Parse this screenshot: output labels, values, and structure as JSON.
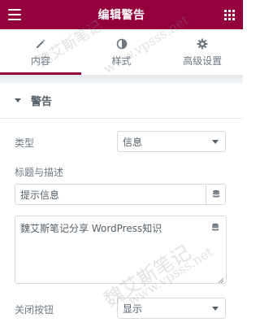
{
  "header": {
    "title": "编辑警告"
  },
  "tabs": [
    {
      "label": "内容",
      "icon": "pencil-icon",
      "active": true
    },
    {
      "label": "样式",
      "icon": "half-circle-icon",
      "active": false
    },
    {
      "label": "高级设置",
      "icon": "gear-icon",
      "active": false
    }
  ],
  "section": {
    "title": "警告"
  },
  "fields": {
    "type_label": "类型",
    "type_value": "信息",
    "title_desc_label": "标题与描述",
    "title_value": "提示信息",
    "description_value": "魏艾斯笔记分享 WordPress知识",
    "close_button_label": "关闭按钮",
    "close_button_value": "显示"
  },
  "watermarks": {
    "w1": "魏艾斯笔记",
    "w2": "www.vpsss.net",
    "w3": "魏艾斯笔记",
    "w4": "www.vpsss.net"
  },
  "colors": {
    "header_bg": "#93003c",
    "active_tab_indicator": "#93003c"
  }
}
